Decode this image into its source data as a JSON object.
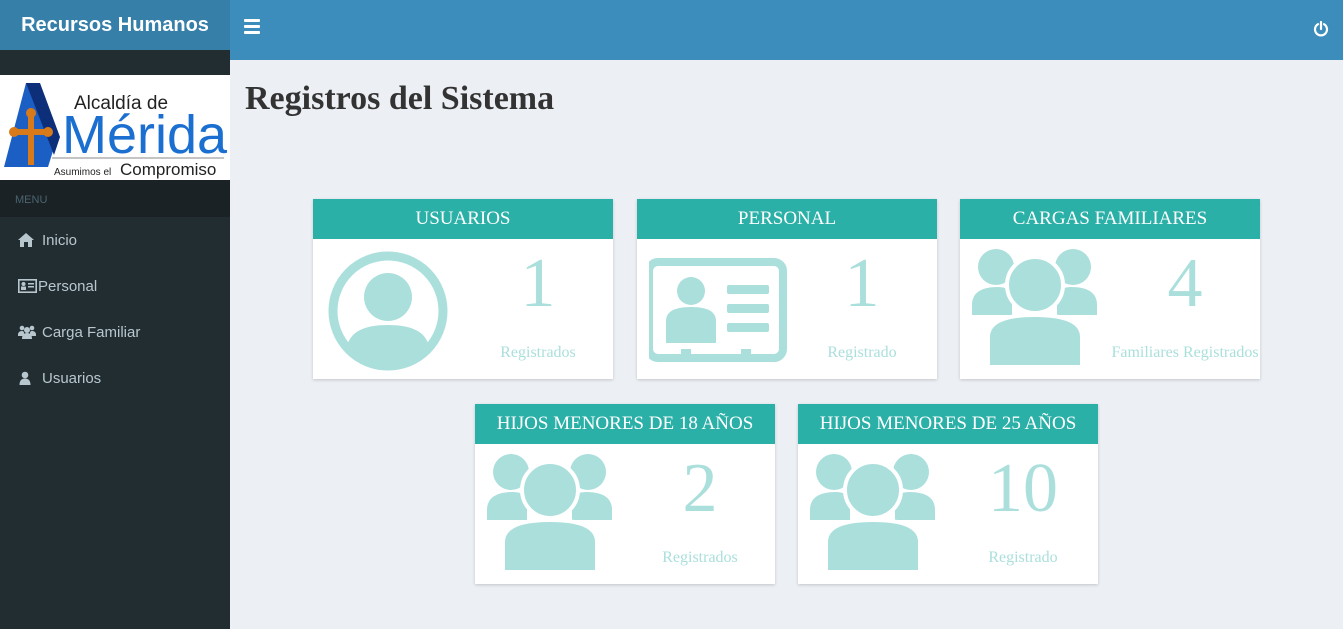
{
  "header": {
    "brand": "Recursos Humanos"
  },
  "logo": {
    "line1": "Alcaldía de",
    "line2": "Mérida",
    "tag_small": "Asumimos el",
    "tag_big": "Compromiso"
  },
  "sidebar": {
    "menu_header": "MENU",
    "items": [
      {
        "label": "Inicio",
        "icon": "home-icon"
      },
      {
        "label": "Personal",
        "icon": "id-card-icon"
      },
      {
        "label": "Carga Familiar",
        "icon": "users-icon"
      },
      {
        "label": "Usuarios",
        "icon": "user-icon"
      }
    ]
  },
  "main": {
    "title": "Registros del Sistema",
    "cards": [
      {
        "title": "USUARIOS",
        "value": "1",
        "label": "Registrados",
        "icon": "user-circle-icon"
      },
      {
        "title": "PERSONAL",
        "value": "1",
        "label": "Registrado",
        "icon": "id-card-icon"
      },
      {
        "title": "CARGAS FAMILIARES",
        "value": "4",
        "label": "Familiares Registrados",
        "icon": "users-icon"
      },
      {
        "title": "HIJOS MENORES DE 18 AÑOS",
        "value": "2",
        "label": "Registrados",
        "icon": "users-icon"
      },
      {
        "title": "HIJOS MENORES DE 25 AÑOS",
        "value": "10",
        "label": "Registrado",
        "icon": "users-icon"
      }
    ]
  },
  "colors": {
    "accent": "#2bb0a8",
    "icon": "#aadfdc",
    "topbar": "#3c8dbc",
    "sidebar": "#222d32"
  }
}
